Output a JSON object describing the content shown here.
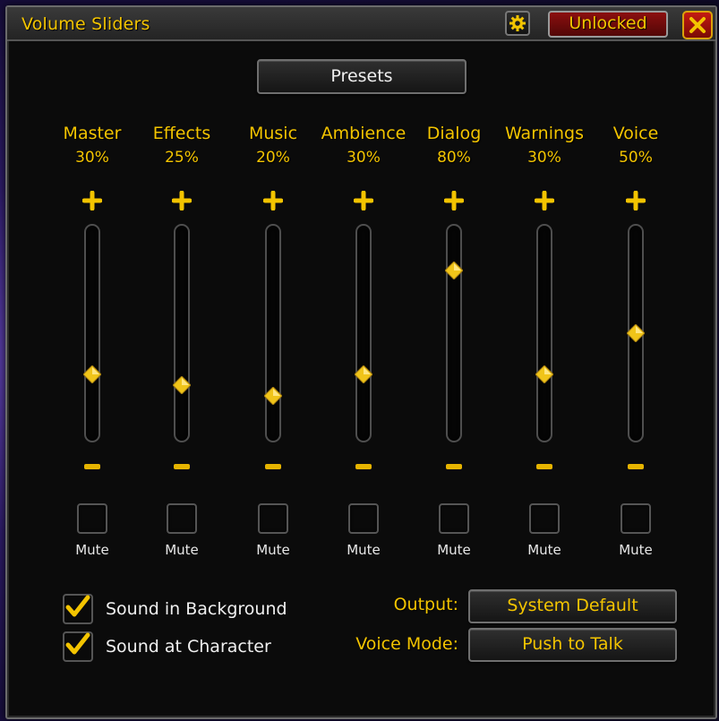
{
  "window": {
    "title": "Volume Sliders",
    "lock_label": "Unlocked",
    "icons": {
      "gear": "gear-icon",
      "close": "close-icon"
    }
  },
  "presets_label": "Presets",
  "channels": [
    {
      "name": "Master",
      "value": "30%",
      "level": 0.3,
      "mute_label": "Mute"
    },
    {
      "name": "Effects",
      "value": "25%",
      "level": 0.25,
      "mute_label": "Mute"
    },
    {
      "name": "Music",
      "value": "20%",
      "level": 0.2,
      "mute_label": "Mute"
    },
    {
      "name": "Ambience",
      "value": "30%",
      "level": 0.3,
      "mute_label": "Mute"
    },
    {
      "name": "Dialog",
      "value": "80%",
      "level": 0.8,
      "mute_label": "Mute"
    },
    {
      "name": "Warnings",
      "value": "30%",
      "level": 0.3,
      "mute_label": "Mute"
    },
    {
      "name": "Voice",
      "value": "50%",
      "level": 0.5,
      "mute_label": "Mute"
    }
  ],
  "checkboxes": [
    {
      "label": "Sound in Background",
      "checked": true
    },
    {
      "label": "Sound at Character",
      "checked": true
    }
  ],
  "output": {
    "label": "Output:",
    "value": "System Default"
  },
  "voice_mode": {
    "label": "Voice Mode:",
    "value": "Push to Talk"
  },
  "colors": {
    "accent": "#f3c400",
    "lock_bg": "#8b0f0f",
    "close_bg": "#c41b12"
  }
}
